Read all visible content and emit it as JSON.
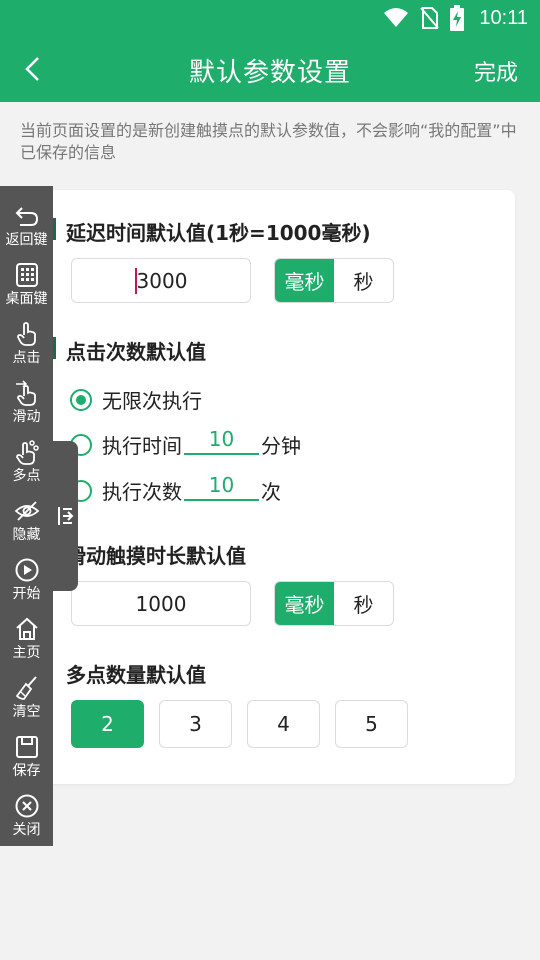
{
  "status": {
    "time": "10:11"
  },
  "appbar": {
    "title": "默认参数设置",
    "done_label": "完成"
  },
  "hint": "当前页面设置的是新创建触摸点的默认参数值，不会影响“我的配置”中已保存的信息",
  "delay": {
    "title": "延迟时间默认值(1秒=1000毫秒)",
    "value": "3000",
    "units": [
      "毫秒",
      "秒"
    ],
    "selected_unit": "毫秒"
  },
  "clicks": {
    "title": "点击次数默认值",
    "options": [
      {
        "label": "无限次执行",
        "checked": true
      },
      {
        "label_before": "执行时间",
        "value": "10",
        "label_after": "分钟",
        "checked": false
      },
      {
        "label_before": "执行次数",
        "value": "10",
        "label_after": "次",
        "checked": false
      }
    ]
  },
  "swipe": {
    "title": "滑动触摸时长默认值",
    "value": "1000",
    "units": [
      "毫秒",
      "秒"
    ],
    "selected_unit": "毫秒"
  },
  "multi": {
    "title": "多点数量默认值",
    "options": [
      "2",
      "3",
      "4",
      "5"
    ],
    "selected": "2"
  },
  "sidebar": {
    "items": [
      {
        "label": "返回键",
        "icon": "back-arrow-icon"
      },
      {
        "label": "桌面键",
        "icon": "grid-icon"
      },
      {
        "label": "点击",
        "icon": "tap-hand-icon"
      },
      {
        "label": "滑动",
        "icon": "swipe-hand-icon"
      },
      {
        "label": "多点",
        "icon": "multi-touch-icon"
      },
      {
        "label": "隐藏",
        "icon": "eye-off-icon"
      },
      {
        "label": "开始",
        "icon": "play-icon"
      },
      {
        "label": "主页",
        "icon": "home-icon"
      },
      {
        "label": "清空",
        "icon": "broom-icon"
      },
      {
        "label": "保存",
        "icon": "save-icon"
      },
      {
        "label": "关闭",
        "icon": "close-circle-icon"
      }
    ]
  },
  "colors": {
    "primary": "#1fad6c",
    "section_mark": "#1b6b45",
    "sidebar": "#555555"
  }
}
